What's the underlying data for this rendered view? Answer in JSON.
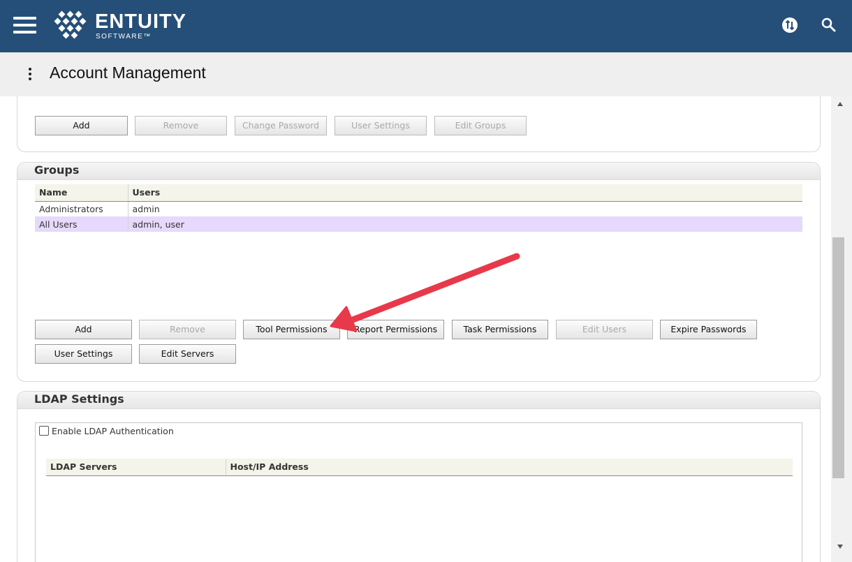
{
  "brand": {
    "name": "ENTUITY",
    "sub": "SOFTWARE™"
  },
  "page": {
    "title": "Account Management"
  },
  "users_panel": {
    "buttons": [
      {
        "label": "Add",
        "enabled": true
      },
      {
        "label": "Remove",
        "enabled": false
      },
      {
        "label": "Change Password",
        "enabled": false
      },
      {
        "label": "User Settings",
        "enabled": false
      },
      {
        "label": "Edit Groups",
        "enabled": false
      }
    ]
  },
  "groups": {
    "title": "Groups",
    "columns": [
      "Name",
      "Users"
    ],
    "rows": [
      {
        "name": "Administrators",
        "users": "admin",
        "selected": false
      },
      {
        "name": "All Users",
        "users": "admin, user",
        "selected": true
      }
    ],
    "buttons": [
      {
        "label": "Add",
        "enabled": true
      },
      {
        "label": "Remove",
        "enabled": false
      },
      {
        "label": "Tool Permissions",
        "enabled": true
      },
      {
        "label": "Report Permissions",
        "enabled": true
      },
      {
        "label": "Task Permissions",
        "enabled": true
      },
      {
        "label": "Edit Users",
        "enabled": false
      },
      {
        "label": "Expire Passwords",
        "enabled": true
      },
      {
        "label": "User Settings",
        "enabled": true
      },
      {
        "label": "Edit Servers",
        "enabled": true
      }
    ]
  },
  "ldap": {
    "title": "LDAP Settings",
    "enable_label": "Enable LDAP Authentication",
    "enabled": false,
    "columns": [
      "LDAP Servers",
      "Host/IP Address"
    ]
  },
  "colors": {
    "header": "#254f78",
    "selected_row": "#e6d9fb",
    "arrow": "#e8394a"
  }
}
